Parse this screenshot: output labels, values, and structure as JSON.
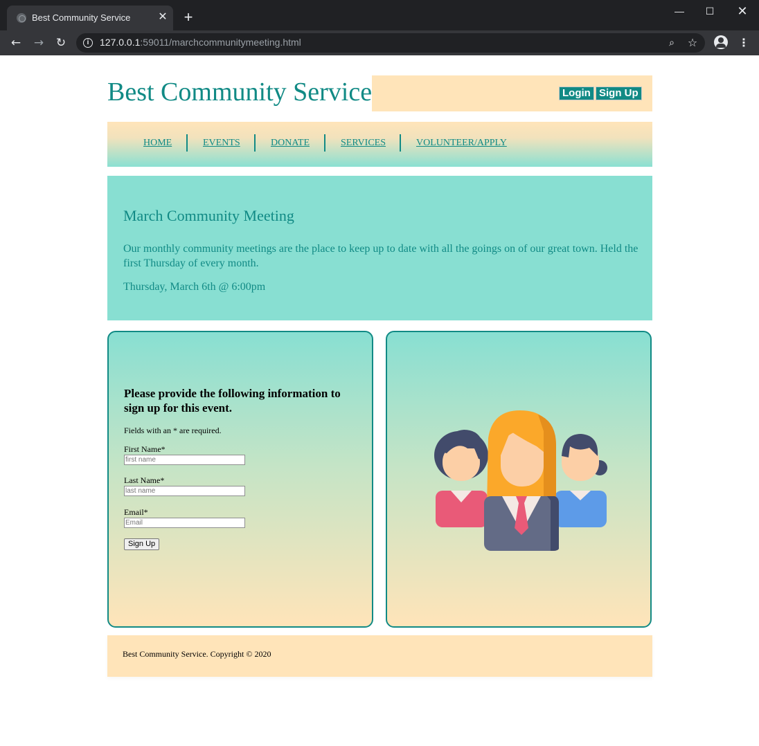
{
  "browser": {
    "tab_title": "Best Community Service",
    "tab_close": "✕",
    "new_tab": "+",
    "url_host": "127.0.0.1",
    "url_rest": ":59011/marchcommunitymeeting.html",
    "window_controls": {
      "minimize": "—",
      "maximize": "☐",
      "close": "✕"
    },
    "nav_icons": {
      "back": "←",
      "forward": "→",
      "reload": "↻",
      "zoom": "⌕",
      "bookmark": "☆",
      "menu": "⋮",
      "info": "i"
    }
  },
  "header": {
    "site_title": "Best Community Service",
    "login_label": "Login",
    "signup_label": "Sign Up"
  },
  "nav": {
    "items": [
      {
        "label": "HOME"
      },
      {
        "label": "EVENTS"
      },
      {
        "label": "DONATE"
      },
      {
        "label": "SERVICES"
      },
      {
        "label": "VOLUNTEER/APPLY"
      }
    ]
  },
  "event": {
    "title": "March Community Meeting",
    "description": "Our monthly community meetings are the place to keep up to date with all the goings on of our great town. Held the first Thursday of every month.",
    "date": "Thursday, March 6th @ 6:00pm"
  },
  "form": {
    "heading": "Please provide the following information to sign up for this event.",
    "note": "Fields with an * are required.",
    "first_name": {
      "label": "First Name*",
      "placeholder": "first name",
      "value": ""
    },
    "last_name": {
      "label": "Last Name*",
      "placeholder": "last name",
      "value": ""
    },
    "email": {
      "label": "Email*",
      "placeholder": "Email",
      "value": ""
    },
    "submit_label": "Sign Up"
  },
  "footer": {
    "text": "Best Community Service. Copyright © 2020"
  },
  "colors": {
    "brand_teal": "#118a85",
    "peach": "#ffe4b9",
    "aqua": "#88dfd2"
  },
  "illustration": {
    "icon": "people-group-icon"
  }
}
